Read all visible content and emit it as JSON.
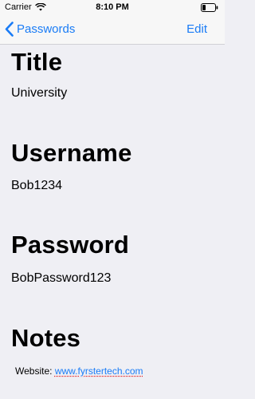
{
  "status_bar": {
    "carrier": "Carrier",
    "time": "8:10 PM",
    "icons": [
      "wifi-icon",
      "battery-icon"
    ]
  },
  "nav": {
    "back_label": "Passwords",
    "edit_label": "Edit",
    "accent_color": "#1a7cf6"
  },
  "sections": {
    "title": {
      "heading": "Title",
      "value": "University"
    },
    "username": {
      "heading": "Username",
      "value": "Bob1234"
    },
    "password": {
      "heading": "Password",
      "value": "BobPassword123"
    },
    "notes": {
      "heading": "Notes",
      "text_prefix": "Website: ",
      "link": "www.fyrstertech.com"
    }
  }
}
